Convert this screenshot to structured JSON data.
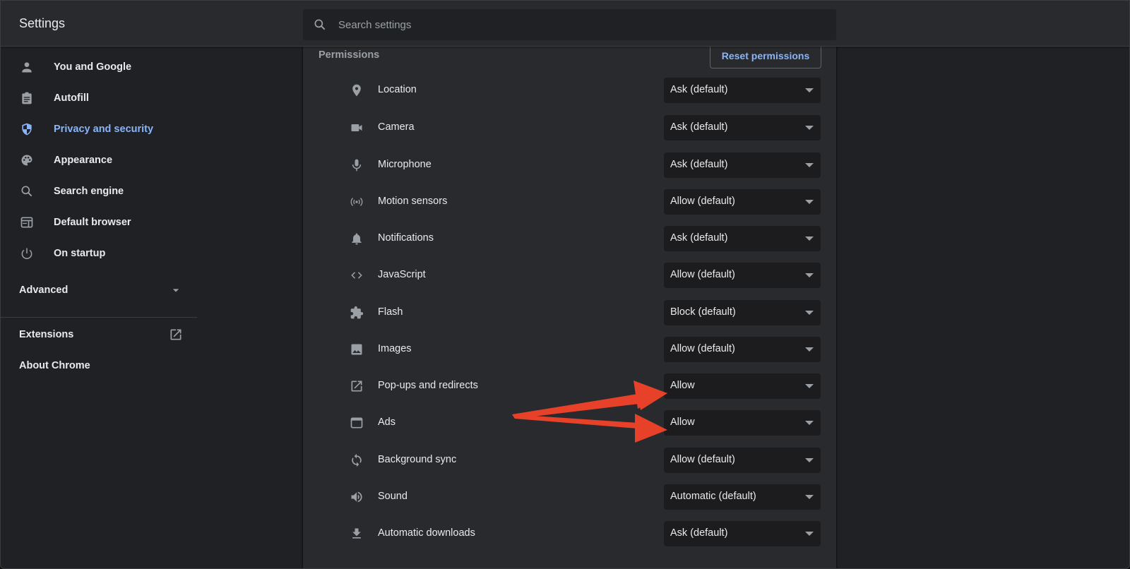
{
  "header": {
    "title": "Settings",
    "search_placeholder": "Search settings",
    "search_value": ""
  },
  "sidebar": {
    "items": [
      {
        "label": "You and Google",
        "icon": "person-icon",
        "active": false
      },
      {
        "label": "Autofill",
        "icon": "clipboard-icon",
        "active": false
      },
      {
        "label": "Privacy and security",
        "icon": "shield-icon",
        "active": true
      },
      {
        "label": "Appearance",
        "icon": "palette-icon",
        "active": false
      },
      {
        "label": "Search engine",
        "icon": "search-icon",
        "active": false
      },
      {
        "label": "Default browser",
        "icon": "browser-icon",
        "active": false
      },
      {
        "label": "On startup",
        "icon": "power-icon",
        "active": false
      }
    ],
    "advanced_label": "Advanced",
    "extensions_label": "Extensions",
    "about_label": "About Chrome"
  },
  "main": {
    "section_title": "Permissions",
    "reset_button": "Reset permissions",
    "permissions": [
      {
        "label": "Location",
        "icon": "location-pin-icon",
        "value": "Ask (default)"
      },
      {
        "label": "Camera",
        "icon": "camera-icon",
        "value": "Ask (default)"
      },
      {
        "label": "Microphone",
        "icon": "microphone-icon",
        "value": "Ask (default)"
      },
      {
        "label": "Motion sensors",
        "icon": "motion-sensors-icon",
        "value": "Allow (default)"
      },
      {
        "label": "Notifications",
        "icon": "bell-icon",
        "value": "Ask (default)"
      },
      {
        "label": "JavaScript",
        "icon": "code-icon",
        "value": "Allow (default)"
      },
      {
        "label": "Flash",
        "icon": "puzzle-icon",
        "value": "Block (default)"
      },
      {
        "label": "Images",
        "icon": "image-icon",
        "value": "Allow (default)"
      },
      {
        "label": "Pop-ups and redirects",
        "icon": "external-link-icon",
        "value": "Allow"
      },
      {
        "label": "Ads",
        "icon": "window-icon",
        "value": "Allow"
      },
      {
        "label": "Background sync",
        "icon": "sync-icon",
        "value": "Allow (default)"
      },
      {
        "label": "Sound",
        "icon": "speaker-icon",
        "value": "Automatic (default)"
      },
      {
        "label": "Automatic downloads",
        "icon": "download-icon",
        "value": "Ask (default)"
      }
    ]
  },
  "colors": {
    "accent": "#8ab4f8",
    "annotation_arrow": "#e8412a"
  }
}
